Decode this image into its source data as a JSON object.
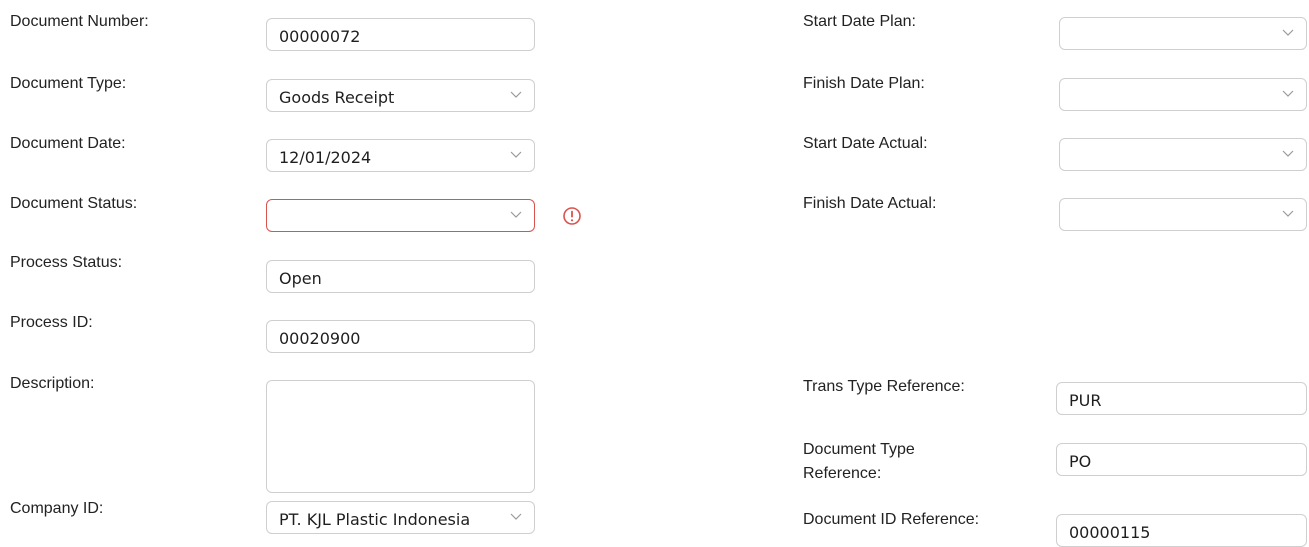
{
  "left": {
    "document_number": {
      "label": "Document Number:",
      "value": "00000072"
    },
    "document_type": {
      "label": "Document Type:",
      "value": "Goods Receipt"
    },
    "document_date": {
      "label": "Document Date:",
      "value": "12/01/2024"
    },
    "document_status": {
      "label": "Document Status:",
      "value": ""
    },
    "process_status": {
      "label": "Process Status:",
      "value": "Open"
    },
    "process_id": {
      "label": "Process ID:",
      "value": "00020900"
    },
    "description": {
      "label": "Description:",
      "value": ""
    },
    "company_id": {
      "label": "Company ID:",
      "value": "PT. KJL Plastic Indonesia"
    }
  },
  "right": {
    "start_date_plan": {
      "label": "Start Date Plan:",
      "value": ""
    },
    "finish_date_plan": {
      "label": "Finish Date Plan:",
      "value": ""
    },
    "start_date_actual": {
      "label": "Start Date Actual:",
      "value": ""
    },
    "finish_date_actual": {
      "label": "Finish Date Actual:",
      "value": ""
    },
    "trans_type_reference": {
      "label": "Trans Type Reference:",
      "value": "PUR"
    },
    "document_type_reference": {
      "label": "Document Type Reference:",
      "value": "PO"
    },
    "document_id_reference": {
      "label": "Document ID Reference:",
      "value": "00000115"
    }
  },
  "icons": {
    "chevron": "chevron-down-icon",
    "error": "error-circle-icon"
  },
  "colors": {
    "error": "#d9534f",
    "border": "#cfcfcf"
  }
}
